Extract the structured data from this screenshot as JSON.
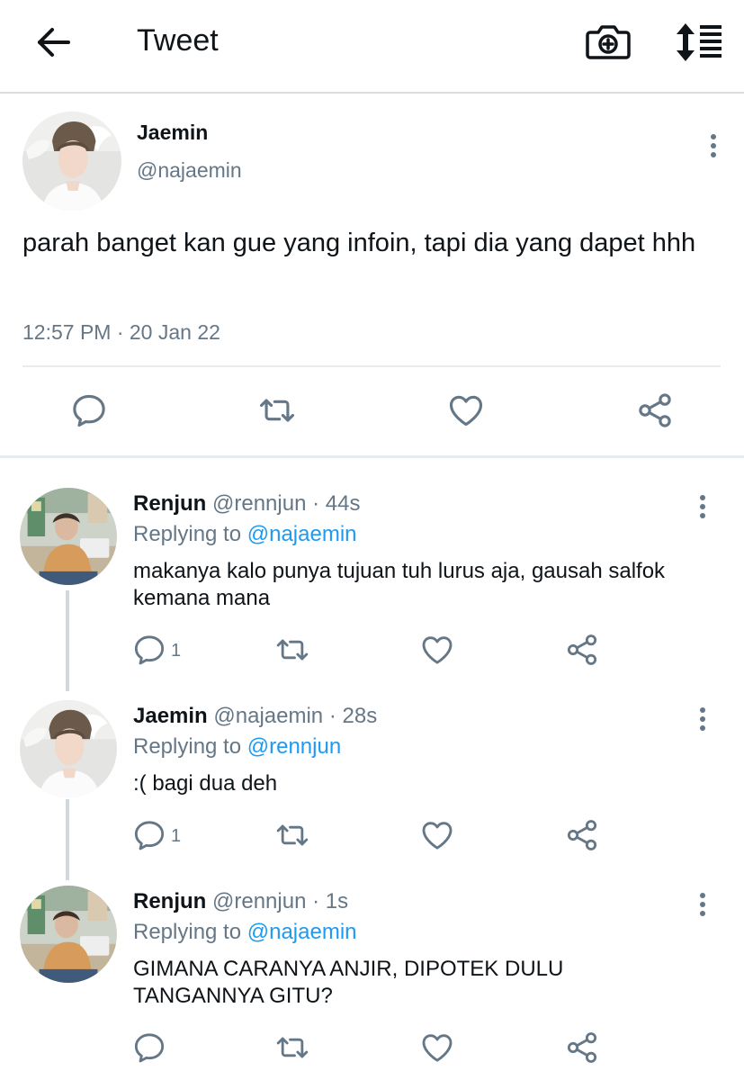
{
  "topbar": {
    "title": "Tweet",
    "back_icon": "arrow-left-icon",
    "camera_icon": "camera-plus-icon",
    "sort_icon": "sort-lines-icon"
  },
  "main_tweet": {
    "name": "Jaemin",
    "handle": "@najaemin",
    "text": "parah banget kan gue yang infoin, tapi dia yang dapet hhh",
    "timestamp": "12:57 PM · 20 Jan 22",
    "actions": [
      "reply-icon",
      "retweet-icon",
      "like-icon",
      "share-icon"
    ]
  },
  "replies": [
    {
      "name": "Renjun",
      "handle": "@rennjun",
      "time": "44s",
      "replying_label": "Replying to",
      "replying_to": "@najaemin",
      "text": "makanya kalo punya tujuan tuh lurus aja, gausah salfok kemana mana",
      "reply_count": "1"
    },
    {
      "name": "Jaemin",
      "handle": "@najaemin",
      "time": "28s",
      "replying_label": "Replying to",
      "replying_to": "@rennjun",
      "text": ":( bagi dua deh",
      "reply_count": "1"
    },
    {
      "name": "Renjun",
      "handle": "@rennjun",
      "time": "1s",
      "replying_label": "Replying to",
      "replying_to": "@najaemin",
      "text": "GIMANA CARANYA ANJIR, DIPOTEK DULU TANGANNYA GITU?",
      "reply_count": ""
    }
  ],
  "colors": {
    "text": "#0f1419",
    "muted": "#657786",
    "link": "#1d9bf0",
    "divider": "#e6ecf0"
  }
}
